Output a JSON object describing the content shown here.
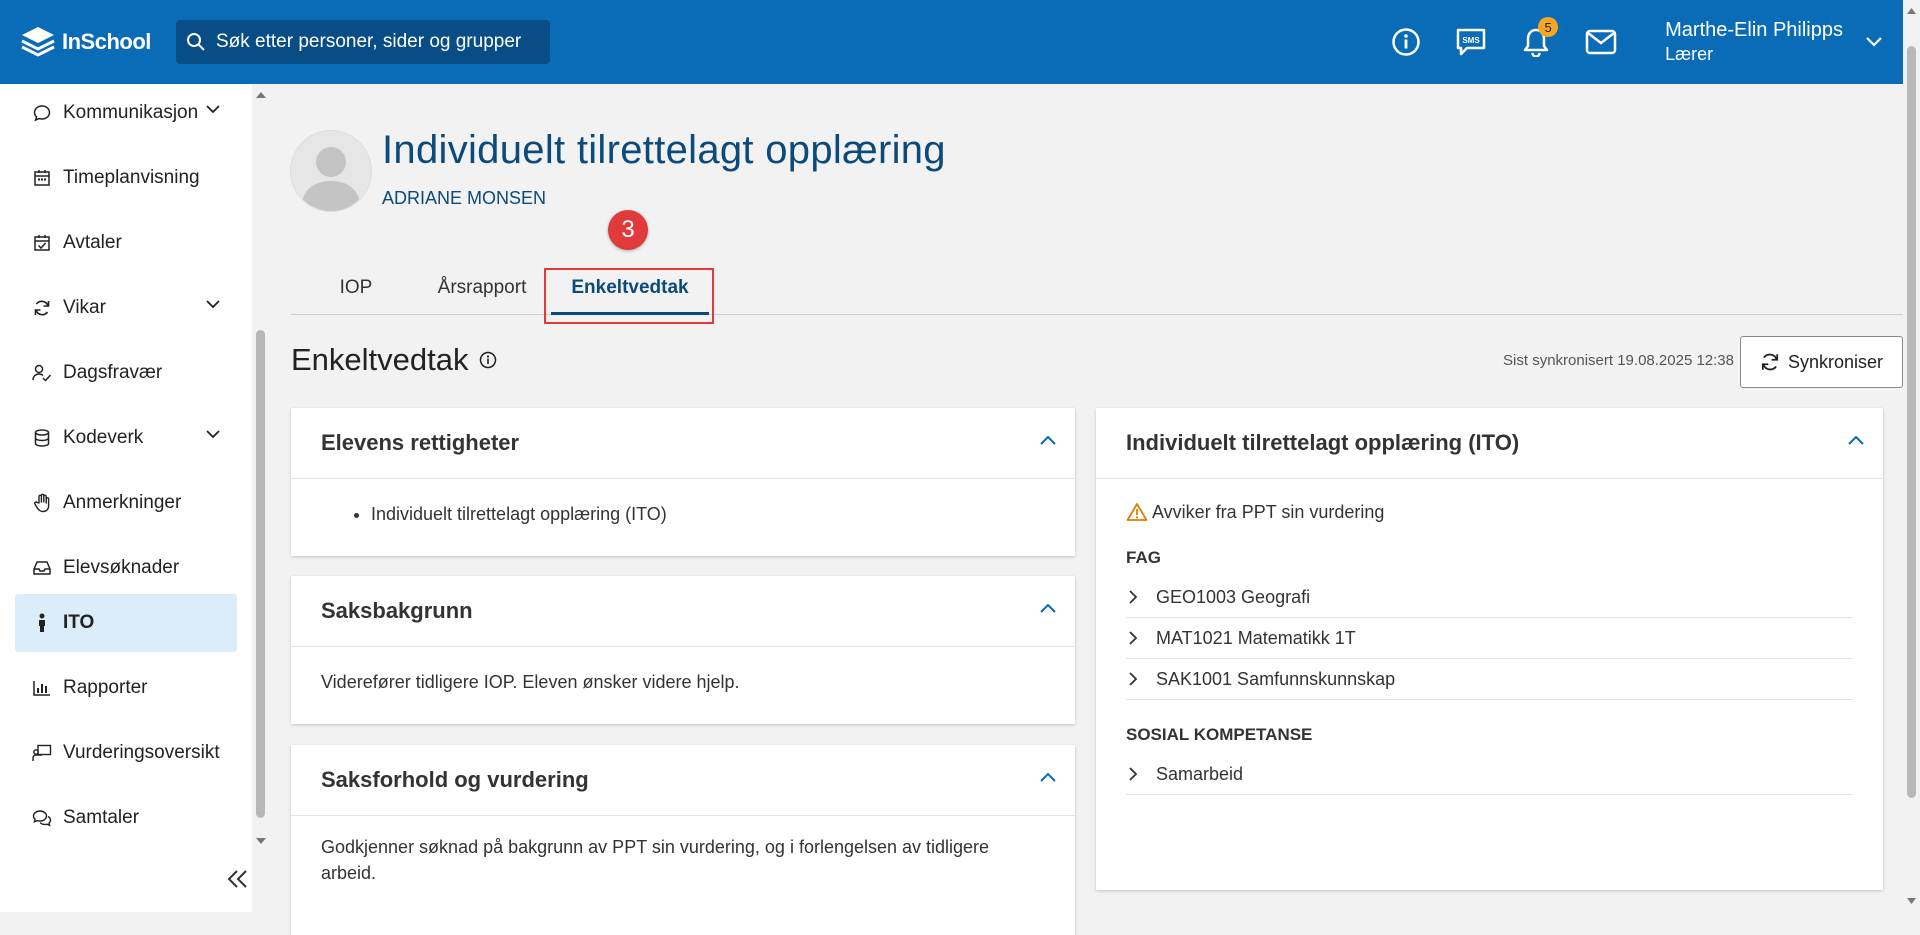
{
  "header": {
    "logo_text": "InSchool",
    "search_placeholder": "Søk etter personer, sider og grupper",
    "notif_count": "5",
    "user_name": "Marthe-Elin Philipps",
    "user_role": "Lærer"
  },
  "sidebar": {
    "items": [
      {
        "label": "Kommunikasjon",
        "icon": "chat-icon",
        "chevron": true
      },
      {
        "label": "Timeplanvisning",
        "icon": "calendar-icon",
        "chevron": false
      },
      {
        "label": "Avtaler",
        "icon": "calendar-check-icon",
        "chevron": false
      },
      {
        "label": "Vikar",
        "icon": "refresh-icon",
        "chevron": true
      },
      {
        "label": "Dagsfravær",
        "icon": "person-check-icon",
        "chevron": false
      },
      {
        "label": "Kodeverk",
        "icon": "database-icon",
        "chevron": true
      },
      {
        "label": "Anmerkninger",
        "icon": "hand-icon",
        "chevron": false
      },
      {
        "label": "Elevsøknader",
        "icon": "inbox-icon",
        "chevron": false
      },
      {
        "label": "ITO",
        "icon": "person-icon",
        "chevron": false,
        "active": true
      },
      {
        "label": "Rapporter",
        "icon": "bar-chart-icon",
        "chevron": false
      },
      {
        "label": "Vurderingsoversikt",
        "icon": "teacher-board-icon",
        "chevron": false
      },
      {
        "label": "Samtaler",
        "icon": "conversation-icon",
        "chevron": false
      }
    ]
  },
  "page": {
    "title": "Individuelt tilrettelagt opplæring",
    "student_name": "ADRIANE MONSEN",
    "step_badge": "3",
    "tabs": [
      "IOP",
      "Årsrapport",
      "Enkeltvedtak"
    ],
    "active_tab": "Enkeltvedtak",
    "section_title": "Enkeltvedtak",
    "sync_text": "Sist synkronisert 19.08.2025 12:38",
    "sync_button": "Synkroniser"
  },
  "cards": {
    "rettigheter": {
      "title": "Elevens rettigheter",
      "items": [
        "Individuelt tilrettelagt opplæring (ITO)"
      ]
    },
    "saksbakgrunn": {
      "title": "Saksbakgrunn",
      "text": "Viderefører tidligere IOP. Eleven ønsker videre hjelp."
    },
    "saksforhold": {
      "title": "Saksforhold og vurdering",
      "text": "Godkjenner søknad på bakgrunn av PPT sin vurdering, og i forlengelsen av tidligere arbeid."
    },
    "ito": {
      "title": "Individuelt tilrettelagt opplæring (ITO)",
      "warning": "Avviker fra PPT sin vurdering",
      "fag_heading": "FAG",
      "fag": [
        "GEO1003 Geografi",
        "MAT1021 Matematikk 1T",
        "SAK1001 Samfunnskunnskap"
      ],
      "sosial_heading": "SOSIAL KOMPETANSE",
      "sosial": [
        "Samarbeid"
      ]
    }
  },
  "colors": {
    "topbar": "#0a6bb7",
    "accent": "#0b4a7a",
    "highlight": "#e03a3a",
    "badge": "#f5a623"
  }
}
